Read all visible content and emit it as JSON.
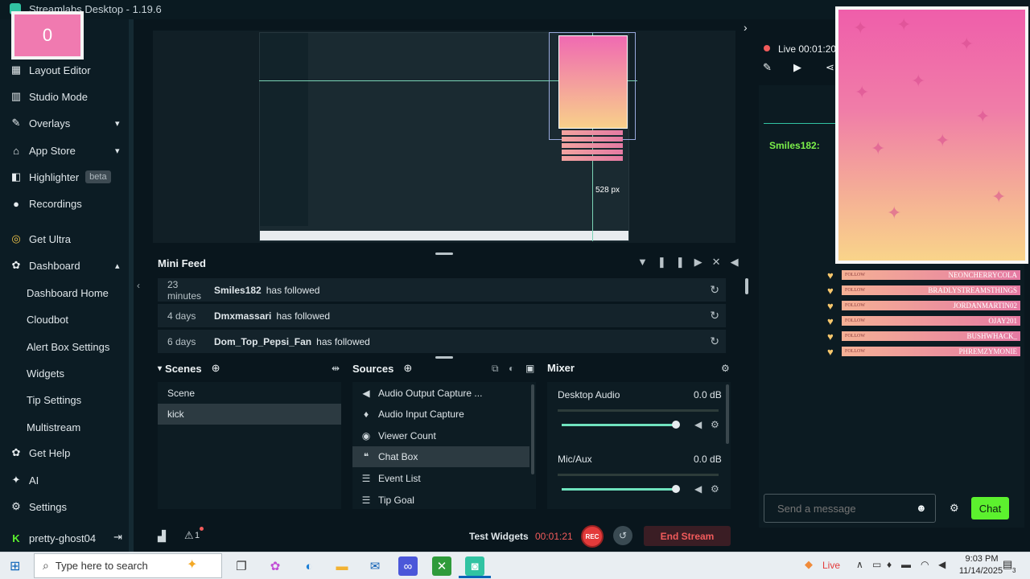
{
  "window": {
    "title": "Streamlabs Desktop - 1.19.6"
  },
  "counter_overlay": {
    "value": "0"
  },
  "sidebar": {
    "items": [
      {
        "label": "Layout Editor",
        "icon": "layout-icon"
      },
      {
        "label": "Studio Mode",
        "icon": "studio-mode-icon"
      },
      {
        "label": "Overlays",
        "icon": "overlays-icon"
      },
      {
        "label": "App Store",
        "icon": "store-icon"
      },
      {
        "label": "Highlighter",
        "icon": "highlighter-icon",
        "badge": "beta"
      },
      {
        "label": "Recordings",
        "icon": "recordings-icon"
      },
      {
        "label": "Get Ultra",
        "icon": "ultra-icon"
      },
      {
        "label": "Dashboard",
        "icon": "dashboard-icon"
      },
      {
        "label": "Dashboard Home"
      },
      {
        "label": "Cloudbot"
      },
      {
        "label": "Alert Box Settings"
      },
      {
        "label": "Widgets"
      },
      {
        "label": "Tip Settings"
      },
      {
        "label": "Multistream"
      },
      {
        "label": "Get Help",
        "icon": "help-icon"
      },
      {
        "label": "AI",
        "icon": "ai-icon"
      },
      {
        "label": "Settings",
        "icon": "settings-icon"
      }
    ],
    "user": "pretty-ghost04"
  },
  "preview": {
    "size_label": "528 px"
  },
  "mini_feed": {
    "title": "Mini Feed",
    "rows": [
      {
        "time": "23 minutes",
        "user": "Smiles182",
        "action": "has followed"
      },
      {
        "time": "4 days",
        "user": "Dmxmassari",
        "action": "has followed"
      },
      {
        "time": "6 days",
        "user": "Dom_Top_Pepsi_Fan",
        "action": "has followed"
      }
    ]
  },
  "scenes": {
    "title": "Scenes",
    "items": [
      "Scene",
      "kick"
    ],
    "selected": "kick"
  },
  "sources": {
    "title": "Sources",
    "items": [
      {
        "label": "Audio Output Capture ...",
        "icon": "speaker-icon"
      },
      {
        "label": "Audio Input Capture",
        "icon": "microphone-icon"
      },
      {
        "label": "Viewer Count",
        "icon": "eye-icon"
      },
      {
        "label": "Chat Box",
        "icon": "chat-icon"
      },
      {
        "label": "Event List",
        "icon": "list-icon"
      },
      {
        "label": "Tip Goal",
        "icon": "list-icon"
      }
    ],
    "selected": "Chat Box"
  },
  "mixer": {
    "title": "Mixer",
    "channels": [
      {
        "name": "Desktop Audio",
        "db": "0.0 dB",
        "level": 1.0
      },
      {
        "name": "Mic/Aux",
        "db": "0.0 dB",
        "level": 1.0
      }
    ]
  },
  "bottom_bar": {
    "test_widgets": "Test Widgets",
    "elapsed": "00:01:21",
    "rec_label": "REC",
    "end_stream": "End Stream",
    "alert_count": "1"
  },
  "right_panel": {
    "live_label": "Live 00:01:20",
    "chat_user": "Smiles182:",
    "chat_placeholder": "Send a message",
    "chat_button": "Chat"
  },
  "alerts": [
    {
      "kind": "FOLLOW",
      "name": "NEONCHERRYCOLA"
    },
    {
      "kind": "FOLLOW",
      "name": "BRADLYSTREAMSTHINGS"
    },
    {
      "kind": "FOLLOW",
      "name": "JORDANMARTIN02"
    },
    {
      "kind": "FOLLOW",
      "name": "OJAY201"
    },
    {
      "kind": "FOLLOW",
      "name": "BUSHWHACK_"
    },
    {
      "kind": "FOLLOW",
      "name": "PHREMZYMONIE"
    }
  ],
  "taskbar": {
    "search_placeholder": "Type here to search",
    "tray_live": "Live",
    "time": "9:03 PM",
    "date": "11/14/2025",
    "notification_count": "3"
  },
  "colors": {
    "accent": "#31c3a2",
    "live_red": "#f15b5b",
    "chat_green": "#5cf12e",
    "overlay_pink": "#ef5eaa"
  }
}
